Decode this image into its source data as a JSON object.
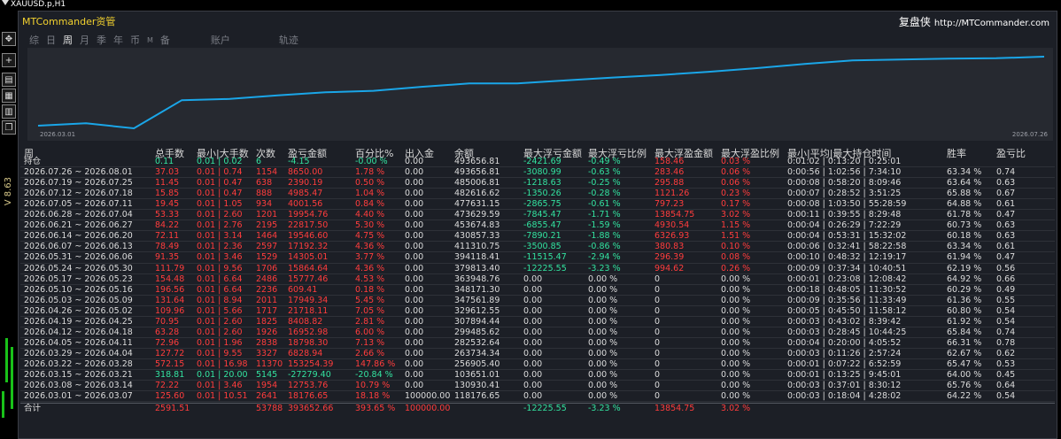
{
  "mt4": {
    "symbol_title": "XAUUSD.p,H1",
    "price_label": "V 8.63",
    "tool_icons": [
      "move-icon",
      "crosshair-icon",
      "chart-icon",
      "grid-icon",
      "layout-icon",
      "window-icon"
    ]
  },
  "header": {
    "title": "MTCommander资管",
    "brand": "复盘侠",
    "url": "http://MTCommander.com"
  },
  "tabs": [
    {
      "label": "综",
      "active": false
    },
    {
      "label": "日",
      "active": false
    },
    {
      "label": "周",
      "active": true
    },
    {
      "label": "月",
      "active": false
    },
    {
      "label": "季",
      "active": false
    },
    {
      "label": "年",
      "active": false
    },
    {
      "label": "币",
      "active": false
    },
    {
      "label": "M",
      "active": false
    },
    {
      "label": "备",
      "active": false
    },
    {
      "label": "账户",
      "active": false
    },
    {
      "label": "轨迹",
      "active": false
    }
  ],
  "chart_data": {
    "type": "line",
    "x_start_label": "2026.03.01",
    "x_end_label": "2026.07.26",
    "line_color": "#1aa6e8",
    "x": [
      "2026.03.01",
      "2026.03.08",
      "2026.03.15",
      "2026.03.22",
      "2026.03.29",
      "2026.04.05",
      "2026.04.12",
      "2026.04.19",
      "2026.04.26",
      "2026.05.03",
      "2026.05.10",
      "2026.05.17",
      "2026.05.24",
      "2026.05.31",
      "2026.06.07",
      "2026.06.14",
      "2026.06.21",
      "2026.06.28",
      "2026.07.05",
      "2026.07.12",
      "2026.07.19",
      "2026.07.26"
    ],
    "values": [
      118176.65,
      130930.41,
      103651.01,
      256905.4,
      263734.34,
      282532.64,
      299485.62,
      307894.44,
      329612.55,
      347561.89,
      348171.3,
      363948.76,
      379813.4,
      394118.41,
      411310.75,
      430857.33,
      453674.83,
      473629.59,
      477631.15,
      482616.62,
      485006.81,
      493656.81
    ]
  },
  "table": {
    "headers": {
      "period": "周",
      "total_lots": "总手数",
      "min_max_lots": "最小|大手数",
      "count": "次数",
      "pnl": "盈亏金额",
      "pct": "百分比%",
      "inout": "出入金",
      "balance": "余额",
      "max_float_loss": "最大浮亏金额",
      "max_float_loss_pct": "最大浮亏比例",
      "max_float_profit": "最大浮盈金额",
      "max_float_profit_pct": "最大浮盈比例",
      "hold_time": "最小|平均|最大持仓时间",
      "win_rate": "胜率",
      "pl_ratio": "盈亏比"
    },
    "rows": [
      {
        "period": "持仓",
        "lots": "0.11",
        "minmax": "0.01 | 0.02",
        "count": "6",
        "pnl": "-4.15",
        "pct": "-0.00 %",
        "inout": "0.00",
        "balance": "493656.81",
        "mfl": "-2421.69",
        "mflp": "-0.49 %",
        "mfp": "158.46",
        "mfpp": "0.03 %",
        "hold": "0:01:02 | 0:13:20 | 0:25:01",
        "win": "",
        "pl": "",
        "tone": "green"
      },
      {
        "period": "2026.07.26 ~ 2026.08.01",
        "lots": "37.03",
        "minmax": "0.01 | 0.74",
        "count": "1154",
        "pnl": "8650.00",
        "pct": "1.78 %",
        "inout": "0.00",
        "balance": "493656.81",
        "mfl": "-3080.99",
        "mflp": "-0.63 %",
        "mfp": "283.46",
        "mfpp": "0.06 %",
        "hold": "0:00:56 | 1:02:56 | 7:34:10",
        "win": "63.34 %",
        "pl": "0.74",
        "tone": "red"
      },
      {
        "period": "2026.07.19 ~ 2026.07.25",
        "lots": "11.45",
        "minmax": "0.01 | 0.47",
        "count": "638",
        "pnl": "2390.19",
        "pct": "0.50 %",
        "inout": "0.00",
        "balance": "485006.81",
        "mfl": "-1218.63",
        "mflp": "-0.25 %",
        "mfp": "295.88",
        "mfpp": "0.06 %",
        "hold": "0:00:08 | 0:58:20 | 8:09:46",
        "win": "63.64 %",
        "pl": "0.63",
        "tone": "red"
      },
      {
        "period": "2026.07.12 ~ 2026.07.18",
        "lots": "15.85",
        "minmax": "0.01 | 0.47",
        "count": "888",
        "pnl": "4985.47",
        "pct": "1.04 %",
        "inout": "0.00",
        "balance": "482616.62",
        "mfl": "-1350.26",
        "mflp": "-0.28 %",
        "mfp": "1121.26",
        "mfpp": "0.23 %",
        "hold": "0:00:07 | 0:28:52 | 3:51:25",
        "win": "65.88 %",
        "pl": "0.67",
        "tone": "red"
      },
      {
        "period": "2026.07.05 ~ 2026.07.11",
        "lots": "19.45",
        "minmax": "0.01 | 1.05",
        "count": "934",
        "pnl": "4001.56",
        "pct": "0.84 %",
        "inout": "0.00",
        "balance": "477631.15",
        "mfl": "-2865.75",
        "mflp": "-0.61 %",
        "mfp": "797.23",
        "mfpp": "0.17 %",
        "hold": "0:00:08 | 1:03:50 | 55:28:59",
        "win": "64.88 %",
        "pl": "0.61",
        "tone": "red"
      },
      {
        "period": "2026.06.28 ~ 2026.07.04",
        "lots": "53.33",
        "minmax": "0.01 | 2.60",
        "count": "1201",
        "pnl": "19954.76",
        "pct": "4.40 %",
        "inout": "0.00",
        "balance": "473629.59",
        "mfl": "-7845.47",
        "mflp": "-1.71 %",
        "mfp": "13854.75",
        "mfpp": "3.02 %",
        "hold": "0:00:11 | 0:39:55 | 8:29:48",
        "win": "61.78 %",
        "pl": "0.47",
        "tone": "red"
      },
      {
        "period": "2026.06.21 ~ 2026.06.27",
        "lots": "84.22",
        "minmax": "0.01 | 2.76",
        "count": "2195",
        "pnl": "22817.50",
        "pct": "5.30 %",
        "inout": "0.00",
        "balance": "453674.83",
        "mfl": "-6855.47",
        "mflp": "-1.59 %",
        "mfp": "4930.54",
        "mfpp": "1.15 %",
        "hold": "0:00:04 | 0:26:29 | 7:22:29",
        "win": "60.73 %",
        "pl": "0.63",
        "tone": "red"
      },
      {
        "period": "2026.06.14 ~ 2026.06.20",
        "lots": "72.11",
        "minmax": "0.01 | 3.14",
        "count": "1464",
        "pnl": "19546.60",
        "pct": "4.75 %",
        "inout": "0.00",
        "balance": "430857.33",
        "mfl": "-7890.21",
        "mflp": "-1.88 %",
        "mfp": "6326.93",
        "mfpp": "1.51 %",
        "hold": "0:00:04 | 0:53:31 | 15:32:02",
        "win": "60.18 %",
        "pl": "0.63",
        "tone": "red"
      },
      {
        "period": "2026.06.07 ~ 2026.06.13",
        "lots": "78.49",
        "minmax": "0.01 | 2.36",
        "count": "2597",
        "pnl": "17192.32",
        "pct": "4.36 %",
        "inout": "0.00",
        "balance": "411310.75",
        "mfl": "-3500.85",
        "mflp": "-0.86 %",
        "mfp": "380.83",
        "mfpp": "0.10 %",
        "hold": "0:00:06 | 0:32:41 | 58:22:58",
        "win": "63.34 %",
        "pl": "0.61",
        "tone": "red"
      },
      {
        "period": "2026.05.31 ~ 2026.06.06",
        "lots": "91.35",
        "minmax": "0.01 | 3.46",
        "count": "1529",
        "pnl": "14305.01",
        "pct": "3.77 %",
        "inout": "0.00",
        "balance": "394118.41",
        "mfl": "-11515.47",
        "mflp": "-2.94 %",
        "mfp": "296.39",
        "mfpp": "0.08 %",
        "hold": "0:00:10 | 0:48:32 | 12:19:17",
        "win": "61.94 %",
        "pl": "0.47",
        "tone": "red"
      },
      {
        "period": "2026.05.24 ~ 2026.05.30",
        "lots": "111.79",
        "minmax": "0.01 | 9.56",
        "count": "1706",
        "pnl": "15864.64",
        "pct": "4.36 %",
        "inout": "0.00",
        "balance": "379813.40",
        "mfl": "-12225.55",
        "mflp": "-3.23 %",
        "mfp": "994.62",
        "mfpp": "0.26 %",
        "hold": "0:00:09 | 0:37:34 | 10:40:51",
        "win": "62.19 %",
        "pl": "0.56",
        "tone": "red"
      },
      {
        "period": "2026.05.17 ~ 2026.05.23",
        "lots": "154.48",
        "minmax": "0.01 | 6.64",
        "count": "2486",
        "pnl": "15777.46",
        "pct": "4.53 %",
        "inout": "0.00",
        "balance": "363948.76",
        "mfl": "0.00",
        "mflp": "0.00 %",
        "mfp": "0",
        "mfpp": "0.00 %",
        "hold": "0:00:01 | 0:23:08 | 12:08:42",
        "win": "64.92 %",
        "pl": "0.66",
        "tone": "red"
      },
      {
        "period": "2026.05.10 ~ 2026.05.16",
        "lots": "196.56",
        "minmax": "0.01 | 6.64",
        "count": "2236",
        "pnl": "609.41",
        "pct": "0.18 %",
        "inout": "0.00",
        "balance": "348171.30",
        "mfl": "0.00",
        "mflp": "0.00 %",
        "mfp": "0",
        "mfpp": "0.00 %",
        "hold": "0:00:18 | 0:48:05 | 11:30:52",
        "win": "60.29 %",
        "pl": "0.49",
        "tone": "red"
      },
      {
        "period": "2026.05.03 ~ 2026.05.09",
        "lots": "131.64",
        "minmax": "0.01 | 8.94",
        "count": "2011",
        "pnl": "17949.34",
        "pct": "5.45 %",
        "inout": "0.00",
        "balance": "347561.89",
        "mfl": "0.00",
        "mflp": "0.00 %",
        "mfp": "0",
        "mfpp": "0.00 %",
        "hold": "0:00:09 | 0:35:56 | 11:33:49",
        "win": "61.36 %",
        "pl": "0.55",
        "tone": "red"
      },
      {
        "period": "2026.04.26 ~ 2026.05.02",
        "lots": "109.96",
        "minmax": "0.01 | 5.66",
        "count": "1717",
        "pnl": "21718.11",
        "pct": "7.05 %",
        "inout": "0.00",
        "balance": "329612.55",
        "mfl": "0.00",
        "mflp": "0.00 %",
        "mfp": "0",
        "mfpp": "0.00 %",
        "hold": "0:00:05 | 0:45:50 | 11:58:12",
        "win": "60.80 %",
        "pl": "0.54",
        "tone": "red"
      },
      {
        "period": "2026.04.19 ~ 2026.04.25",
        "lots": "70.95",
        "minmax": "0.01 | 2.60",
        "count": "1825",
        "pnl": "8408.82",
        "pct": "2.81 %",
        "inout": "0.00",
        "balance": "307894.44",
        "mfl": "0.00",
        "mflp": "0.00 %",
        "mfp": "0",
        "mfpp": "0.00 %",
        "hold": "0:00:03 | 0:43:02 | 8:39:42",
        "win": "61.92 %",
        "pl": "0.54",
        "tone": "red"
      },
      {
        "period": "2026.04.12 ~ 2026.04.18",
        "lots": "63.28",
        "minmax": "0.01 | 2.60",
        "count": "1926",
        "pnl": "16952.98",
        "pct": "6.00 %",
        "inout": "0.00",
        "balance": "299485.62",
        "mfl": "0.00",
        "mflp": "0.00 %",
        "mfp": "0",
        "mfpp": "0.00 %",
        "hold": "0:00:03 | 0:28:45 | 10:44:25",
        "win": "65.84 %",
        "pl": "0.74",
        "tone": "red"
      },
      {
        "period": "2026.04.05 ~ 2026.04.11",
        "lots": "72.96",
        "minmax": "0.01 | 1.96",
        "count": "2838",
        "pnl": "18798.30",
        "pct": "7.13 %",
        "inout": "0.00",
        "balance": "282532.64",
        "mfl": "0.00",
        "mflp": "0.00 %",
        "mfp": "0",
        "mfpp": "0.00 %",
        "hold": "0:00:04 | 0:20:00 | 4:05:52",
        "win": "66.31 %",
        "pl": "0.78",
        "tone": "red"
      },
      {
        "period": "2026.03.29 ~ 2026.04.04",
        "lots": "127.72",
        "minmax": "0.01 | 9.55",
        "count": "3327",
        "pnl": "6828.94",
        "pct": "2.66 %",
        "inout": "0.00",
        "balance": "263734.34",
        "mfl": "0.00",
        "mflp": "0.00 %",
        "mfp": "0",
        "mfpp": "0.00 %",
        "hold": "0:00:03 | 0:11:26 | 2:57:24",
        "win": "62.67 %",
        "pl": "0.62",
        "tone": "red"
      },
      {
        "period": "2026.03.22 ~ 2026.03.28",
        "lots": "572.15",
        "minmax": "0.01 | 16.98",
        "count": "11370",
        "pnl": "153254.39",
        "pct": "147.86 %",
        "inout": "0.00",
        "balance": "256905.40",
        "mfl": "0.00",
        "mflp": "0.00 %",
        "mfp": "0",
        "mfpp": "0.00 %",
        "hold": "0:00:01 | 0:07:22 | 6:52:59",
        "win": "65.47 %",
        "pl": "0.53",
        "tone": "red"
      },
      {
        "period": "2026.03.15 ~ 2026.03.21",
        "lots": "318.81",
        "minmax": "0.01 | 20.00",
        "count": "5145",
        "pnl": "-27279.40",
        "pct": "-20.84 %",
        "inout": "0.00",
        "balance": "103651.01",
        "mfl": "0.00",
        "mflp": "0.00 %",
        "mfp": "0",
        "mfpp": "0.00 %",
        "hold": "0:00:01 | 0:13:25 | 9:45:01",
        "win": "64.00 %",
        "pl": "0.45",
        "tone": "green"
      },
      {
        "period": "2026.03.08 ~ 2026.03.14",
        "lots": "72.22",
        "minmax": "0.01 | 3.46",
        "count": "1954",
        "pnl": "12753.76",
        "pct": "10.79 %",
        "inout": "0.00",
        "balance": "130930.41",
        "mfl": "0.00",
        "mflp": "0.00 %",
        "mfp": "0",
        "mfpp": "0.00 %",
        "hold": "0:00:03 | 0:37:01 | 8:30:12",
        "win": "65.76 %",
        "pl": "0.64",
        "tone": "red"
      },
      {
        "period": "2026.03.01 ~ 2026.03.07",
        "lots": "125.60",
        "minmax": "0.01 | 10.51",
        "count": "2641",
        "pnl": "18176.65",
        "pct": "18.18 %",
        "inout": "100000.00",
        "balance": "118176.65",
        "mfl": "0.00",
        "mflp": "0.00 %",
        "mfp": "0",
        "mfpp": "0.00 %",
        "hold": "0:00:03 | 0:18:04 | 4:28:02",
        "win": "64.22 %",
        "pl": "0.54",
        "tone": "red"
      }
    ],
    "total": {
      "period": "合计",
      "lots": "2591.51",
      "count": "53788",
      "pnl": "393652.66",
      "pct": "393.65 %",
      "inout": "100000.00",
      "mfl": "-12225.55",
      "mflp": "-3.23 %",
      "mfp": "13854.75",
      "mfpp": "3.02 %"
    }
  }
}
